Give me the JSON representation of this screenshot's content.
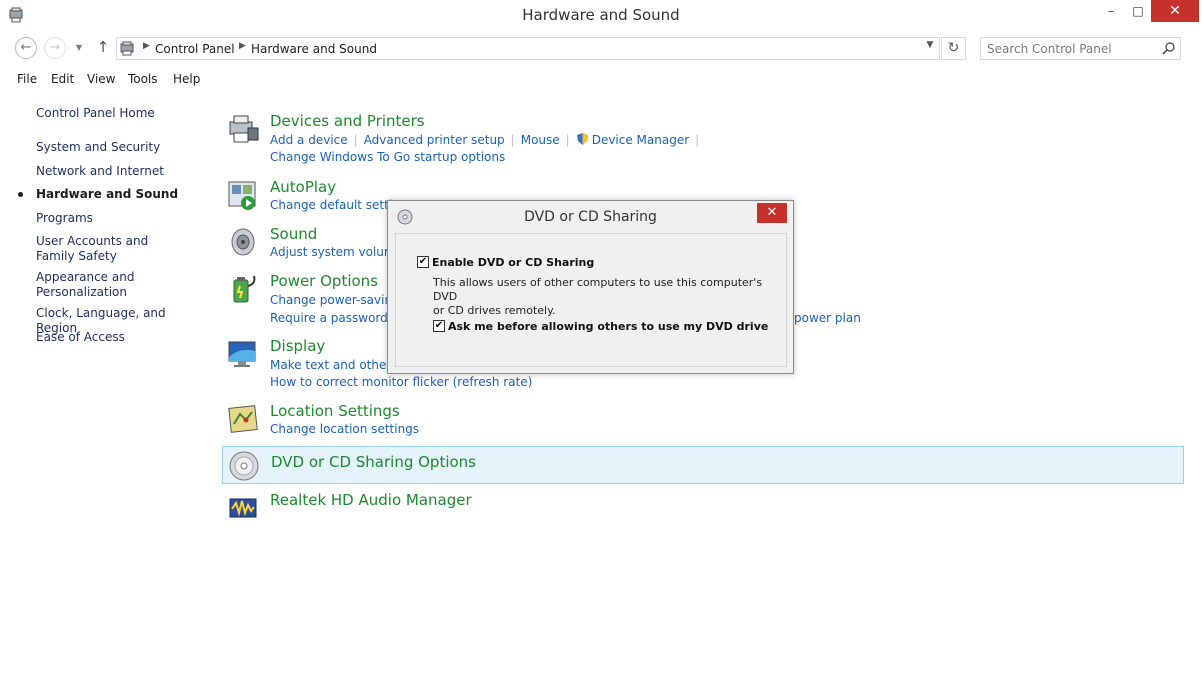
{
  "window": {
    "title": "Hardware and Sound",
    "min": "–",
    "max": "□",
    "close": "✕"
  },
  "address": {
    "crumbs": [
      "Control Panel",
      "Hardware and Sound"
    ],
    "search_placeholder": "Search Control Panel"
  },
  "menu": [
    "File",
    "Edit",
    "View",
    "Tools",
    "Help"
  ],
  "sidebar": {
    "home": "Control Panel Home",
    "items": [
      "System and Security",
      "Network and Internet",
      "Hardware and Sound",
      "Programs",
      "User Accounts and Family Safety",
      "Appearance and Personalization",
      "Clock, Language, and Region",
      "Ease of Access"
    ],
    "active_index": 2
  },
  "categories": {
    "devices": {
      "title": "Devices and Printers",
      "links": [
        "Add a device",
        "Advanced printer setup",
        "Mouse",
        "Device Manager"
      ],
      "links2": [
        "Change Windows To Go startup options"
      ]
    },
    "autoplay": {
      "title": "AutoPlay",
      "links": [
        "Change default settings"
      ]
    },
    "sound": {
      "title": "Sound",
      "links": [
        "Adjust system volume"
      ]
    },
    "power": {
      "title": "Power Options",
      "links": [
        "Change power-saving"
      ],
      "links2": [
        "Require a password wh"
      ],
      "links2_tail": "power plan"
    },
    "display": {
      "title": "Display",
      "links": [
        "Make text and other ite"
      ],
      "links2": [
        "How to correct monitor flicker (refresh rate)"
      ]
    },
    "location": {
      "title": "Location Settings",
      "links": [
        "Change location settings"
      ]
    },
    "dvd": {
      "title": "DVD or CD Sharing Options"
    },
    "realtek": {
      "title": "Realtek HD Audio Manager"
    }
  },
  "dialog": {
    "title": "DVD or CD Sharing",
    "close": "✕",
    "enable_label": "Enable DVD or CD Sharing",
    "enable_checked": true,
    "description_line1": "This allows users of other computers to use this computer's DVD",
    "description_line2": "or CD drives remotely.",
    "ask_label": "Ask me before allowing others to use my DVD drive",
    "ask_checked": true,
    "check_glyph": "✔"
  }
}
